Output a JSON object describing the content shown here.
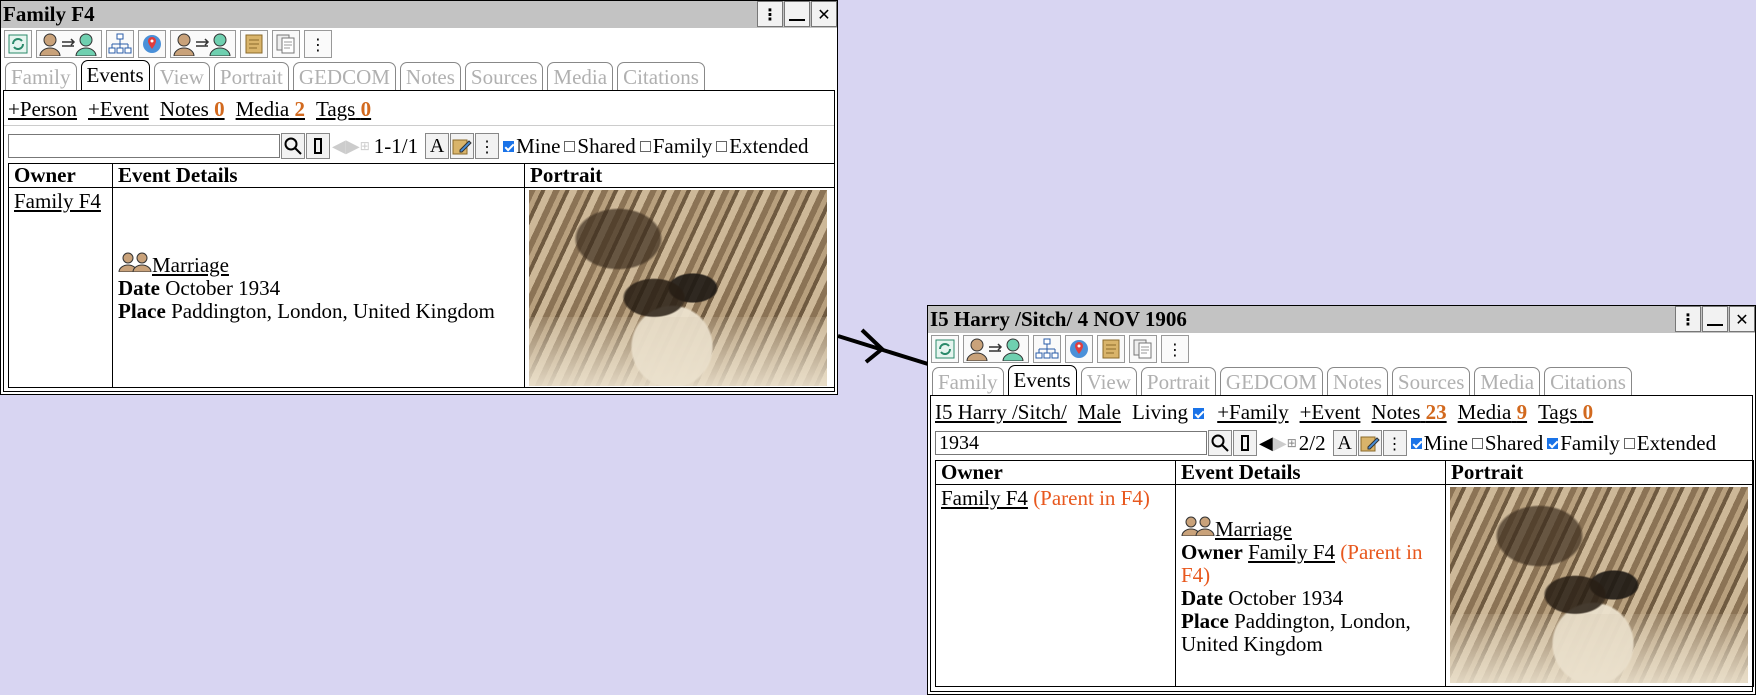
{
  "panel1": {
    "title": "Family F4",
    "tabs": [
      "Family",
      "Events",
      "View",
      "Portrait",
      "GEDCOM",
      "Notes",
      "Sources",
      "Media",
      "Citations"
    ],
    "active_tab": "Events",
    "links": {
      "add_person": "+Person",
      "add_event": "+Event",
      "notes_label": "Notes",
      "notes_count": "0",
      "media_label": "Media",
      "media_count": "2",
      "tags_label": "Tags",
      "tags_count": "0"
    },
    "search": {
      "value": "",
      "pager": "1-1/1"
    },
    "filters": {
      "mine": "Mine",
      "shared": "Shared",
      "family": "Family",
      "extended": "Extended"
    },
    "filter_state": {
      "mine": true,
      "shared": false,
      "family": false,
      "extended": false
    },
    "table": {
      "headers": [
        "Owner",
        "Event Details",
        "Portrait"
      ],
      "row": {
        "owner": "Family F4",
        "event_type": "Marriage",
        "date_label": "Date",
        "date_value": "October 1934",
        "place_label": "Place",
        "place_value": "Paddington, London, United Kingdom"
      }
    }
  },
  "panel2": {
    "title": "I5 Harry /Sitch/ 4 NOV 1906",
    "tabs": [
      "Family",
      "Events",
      "View",
      "Portrait",
      "GEDCOM",
      "Notes",
      "Sources",
      "Media",
      "Citations"
    ],
    "active_tab": "Events",
    "links": {
      "person": "I5 Harry /Sitch/",
      "sex": "Male",
      "living": "Living",
      "add_family": "+Family",
      "add_event": "+Event",
      "notes_label": "Notes",
      "notes_count": "23",
      "media_label": "Media",
      "media_count": "9",
      "tags_label": "Tags",
      "tags_count": "0"
    },
    "search": {
      "value": "1934",
      "pager": "2/2"
    },
    "filters": {
      "mine": "Mine",
      "shared": "Shared",
      "family": "Family",
      "extended": "Extended"
    },
    "filter_state": {
      "mine": true,
      "shared": false,
      "family": true,
      "extended": false
    },
    "table": {
      "headers": [
        "Owner",
        "Event Details",
        "Portrait"
      ],
      "row": {
        "owner": "Family F4",
        "owner_role": "(Parent in F4)",
        "event_type": "Marriage",
        "owner_label": "Owner",
        "owner_value": "Family F4",
        "owner_value_role": "(Parent in",
        "owner_value_role2": "F4)",
        "date_label": "Date",
        "date_value": "October 1934",
        "place_label": "Place",
        "place_value_1": "Paddington, London,",
        "place_value_2": "United Kingdom"
      }
    }
  },
  "colors": {
    "background": "#d8d5f2",
    "titlebar": "#c3c3c3",
    "count": "#d2691e",
    "role": "#e8581e",
    "check": "#1a73e8"
  },
  "icons": [
    "refresh-icon",
    "swap-persons-icon",
    "tree-chart-icon",
    "map-pin-icon",
    "scroll-icon",
    "copy-icon",
    "more-icon",
    "search-icon",
    "minimize-icon",
    "close-icon"
  ]
}
